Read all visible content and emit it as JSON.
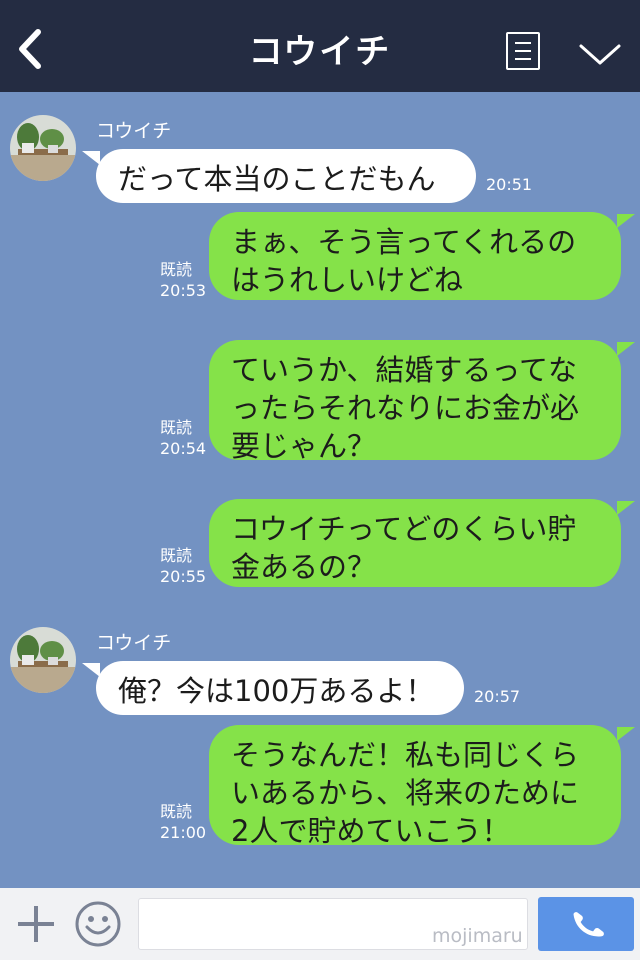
{
  "header": {
    "title": "コウイチ",
    "back_icon": "back-chevron-icon",
    "menu_icon": "note-icon",
    "dropdown_icon": "chevron-down-icon"
  },
  "messages": [
    {
      "side": "in",
      "sender": "コウイチ",
      "lines": [
        "だって本当のことだもん"
      ],
      "time": "20:51"
    },
    {
      "side": "out",
      "lines": [
        "まぁ、そう言ってくれるの",
        "はうれしいけどね"
      ],
      "read": "既読",
      "time": "20:53"
    },
    {
      "side": "out",
      "lines": [
        "ていうか、結婚するってな",
        "ったらそれなりにお金が必",
        "要じゃん？"
      ],
      "read": "既読",
      "time": "20:54"
    },
    {
      "side": "out",
      "lines": [
        "コウイチってどのくらい貯",
        "金あるの？"
      ],
      "read": "既読",
      "time": "20:55"
    },
    {
      "side": "in",
      "sender": "コウイチ",
      "lines": [
        "俺？今は100万あるよ！"
      ],
      "time": "20:57"
    },
    {
      "side": "out",
      "lines": [
        "そうなんだ！私も同じくら",
        "いあるから、将来のために",
        "2人で貯めていこう！"
      ],
      "read": "既読",
      "time": "21:00"
    }
  ],
  "footer": {
    "watermark": "mojimaru",
    "input_placeholder": "",
    "plus_icon": "plus-icon",
    "emoji_icon": "smiley-icon",
    "call_icon": "phone-icon"
  },
  "colors": {
    "header": "#242c42",
    "background": "#7392c2",
    "outgoing_bubble": "#85e249",
    "incoming_bubble": "#ffffff",
    "call_button": "#5b93e6"
  }
}
